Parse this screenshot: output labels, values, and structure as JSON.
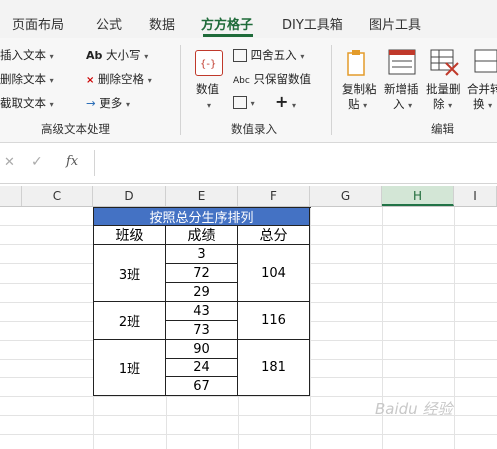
{
  "tabs": [
    {
      "label": "页面布局",
      "active": false
    },
    {
      "label": "公式",
      "active": false
    },
    {
      "label": "数据",
      "active": false
    },
    {
      "label": "方方格子",
      "active": true
    },
    {
      "label": "DIY工具箱",
      "active": false
    },
    {
      "label": "图片工具",
      "active": false
    }
  ],
  "ribbon": {
    "text_group": {
      "insert_text": "插入文本",
      "delete_text": "删除文本",
      "extract_text": "截取文本",
      "case_label": "大小写",
      "case_icon": "Ab",
      "delete_space": "删除空格",
      "more": "更多",
      "group_label": "高级文本处理"
    },
    "number_group": {
      "value": "数值",
      "round": "四舍五入",
      "keep_value": "只保留数值",
      "group_label": "数值录入"
    },
    "edit_group": {
      "copy_paste_1": "复制粘",
      "copy_paste_2": "贴",
      "insert_1": "新增插",
      "insert_2": "入",
      "bulk_delete_1": "批量删",
      "bulk_delete_2": "除",
      "merge_1": "合并转",
      "merge_2": "换",
      "group_label": "编辑"
    },
    "accent_color": "#1f6b3a"
  },
  "formula_bar": {
    "fx_label": "fx",
    "value": ""
  },
  "columns": [
    "C",
    "D",
    "E",
    "F",
    "G",
    "H",
    "I"
  ],
  "selected_column": "H",
  "table": {
    "title": "按照总分生序排列",
    "title_bg": "#4472c4",
    "headers": [
      "班级",
      "成绩",
      "总分"
    ],
    "rows": [
      {
        "class": "3班",
        "scores": [
          "3",
          "72",
          "29"
        ],
        "total": "104"
      },
      {
        "class": "2班",
        "scores": [
          "43",
          "73"
        ],
        "total": "116"
      },
      {
        "class": "1班",
        "scores": [
          "90",
          "24",
          "67"
        ],
        "total": "181"
      }
    ]
  },
  "watermark": "Baidu 经验"
}
